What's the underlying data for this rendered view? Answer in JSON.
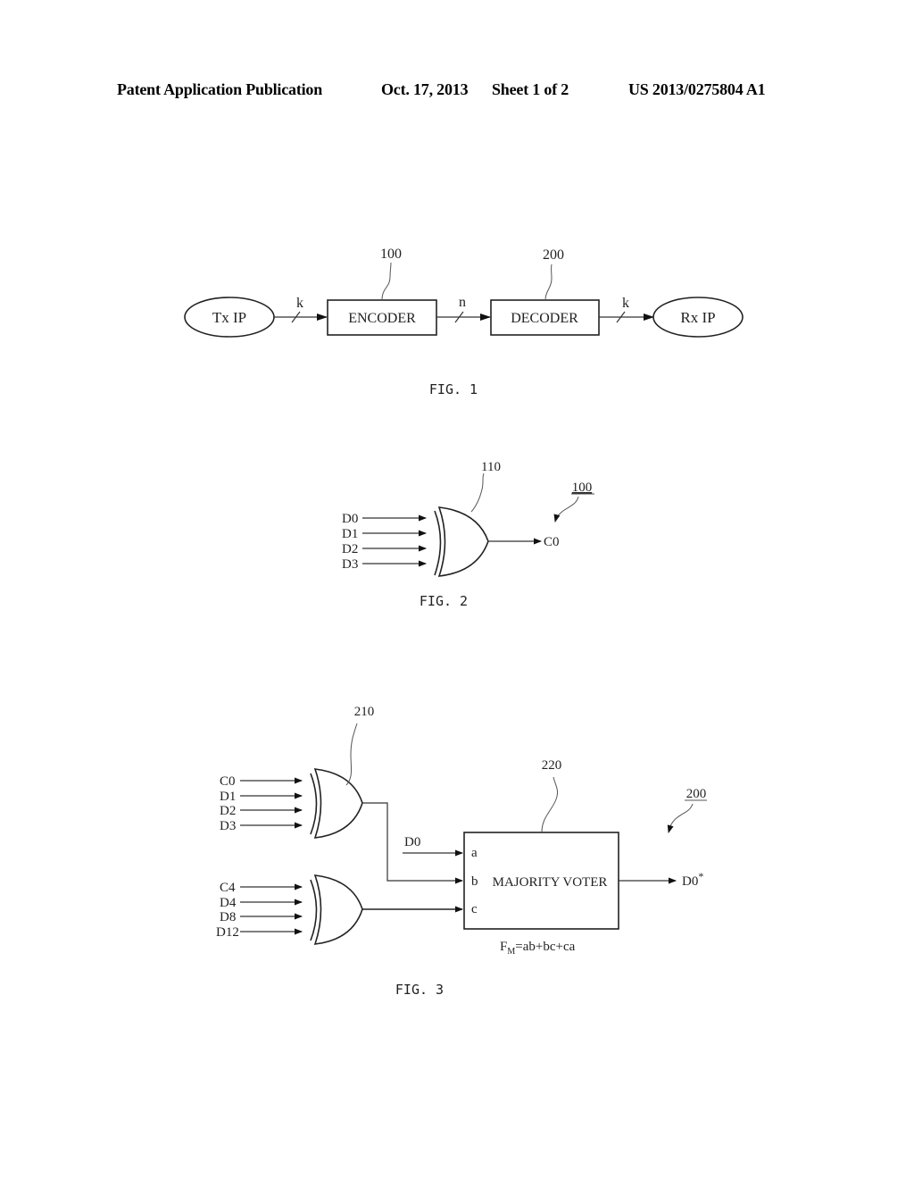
{
  "header": {
    "publication": "Patent Application Publication",
    "date": "Oct. 17, 2013",
    "sheet": "Sheet 1 of 2",
    "number": "US 2013/0275804 A1"
  },
  "fig1": {
    "caption": "FIG. 1",
    "tx": "Tx IP",
    "rx": "Rx IP",
    "encoder": "ENCODER",
    "decoder": "DECODER",
    "ref_encoder": "100",
    "ref_decoder": "200",
    "bus_in": "k",
    "bus_mid": "n",
    "bus_out": "k"
  },
  "fig2": {
    "caption": "FIG. 2",
    "ref_gate": "110",
    "ref_block": "100",
    "inputs": [
      "D0",
      "D1",
      "D2",
      "D3"
    ],
    "output": "C0"
  },
  "fig3": {
    "caption": "FIG. 3",
    "ref_gate": "210",
    "ref_voter": "220",
    "ref_block": "200",
    "gate1_inputs": [
      "C0",
      "D1",
      "D2",
      "D3"
    ],
    "gate2_inputs": [
      "C4",
      "D4",
      "D8",
      "D12"
    ],
    "direct_input": "D0",
    "ports": [
      "a",
      "b",
      "c"
    ],
    "voter": "MAJORITY VOTER",
    "output": "D0",
    "output_sup": "*",
    "formula_f": "F",
    "formula_sub": "M",
    "formula_rest": "=ab+bc+ca"
  }
}
